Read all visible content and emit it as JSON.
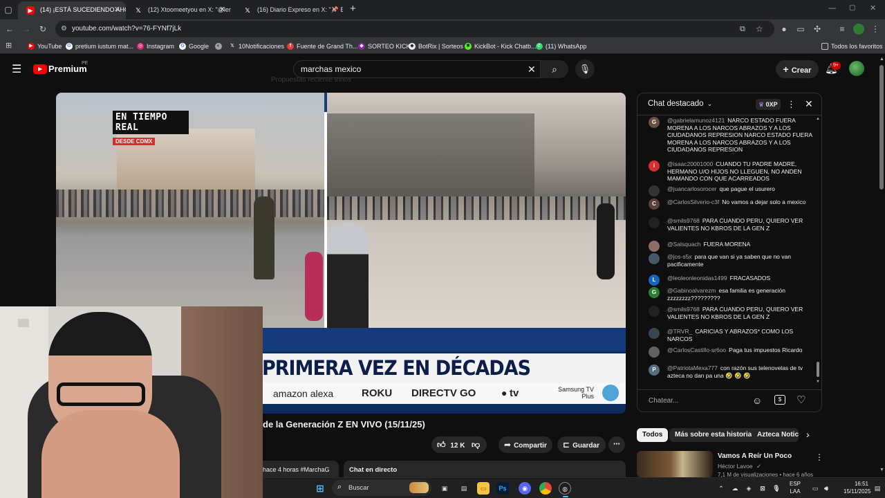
{
  "browser": {
    "tabs": [
      {
        "title": "(14) ¡ESTÁ SUCEDIENDO AHORA",
        "icon": "youtube-icon"
      },
      {
        "title": "(12) Xtoomeetyou en X: \"@lene",
        "icon": "x-icon"
      },
      {
        "title": "(16) Diario Expreso en X: \"📌 E",
        "icon": "x-icon"
      }
    ],
    "new_tab": "+",
    "url": "youtube.com/watch?v=76-FYNf7jLk",
    "bookmarks": [
      "YouTube",
      "pretium iustum mat...",
      "Instagram",
      "Google",
      "",
      "10Notificaciones",
      "Fuente de Grand Th...",
      "SORTEO KICK",
      "BotRix | Sorteos",
      "KickBot - Kick Chatb...",
      "(11) WhatsApp"
    ],
    "all_bookmarks": "Todos los favoritos"
  },
  "youtube": {
    "logo_text": "Premium",
    "logo_region": "PE",
    "search_value": "marchas mexico",
    "create_label": "Crear",
    "notif_count": "9+",
    "ghost_text": "Propuestas reciente trinos"
  },
  "video": {
    "overlay_live": "EN TIEMPO REAL",
    "overlay_source": "DESDE CDMX",
    "banner": "PIA EL ZÓCALO POR PRIMERA VEZ EN DÉCADAS",
    "partners": [
      "amazon alexa",
      "ROKU",
      "DIRECTV GO",
      "tv",
      "Samsung TV Plus"
    ]
  },
  "below": {
    "title": "de la Generación Z EN VIVO (15/11/25)",
    "likes": "12 K",
    "share": "Compartir",
    "save": "Guardar",
    "meta": "hace 4 horas  #MarchaG",
    "live_chat": "Chat en directo"
  },
  "chat": {
    "header": "Chat destacado",
    "xp": "0XP",
    "placeholder": "Chatear...",
    "messages": [
      {
        "author": "@gabrielamunoz4121",
        "text": "NARCO ESTADO FUERA MORENA A LOS NARCOS ABRAZOS Y A LOS CIUDADANOS REPRESION NARCO ESTADO FUERA MORENA A LOS NARCOS ABRAZOS Y A LOS CIUDADANOS REPRESION",
        "av": "G",
        "color": "#6d4c41"
      },
      {
        "author": "@isaac20001000",
        "text": "CUANDO TU PADRE MADRE, HERMANO U/O HIJOS NO LLEGUEN, NO ANDEN MAMANDO CON QUE ACARREADOS",
        "av": "i",
        "color": "#d32f2f"
      },
      {
        "author": "@juancarlosorocer",
        "text": "que pague el usurero",
        "av": "",
        "color": "#333333"
      },
      {
        "author": "@CarlosSilverio-c3f",
        "text": "No vamos a dejar solo a mexico",
        "av": "C",
        "color": "#5d4037"
      },
      {
        "author": "@smils9768",
        "text": "PARA CUANDO PERU, QUIERO VER VALIENTES NO KBROS DE LA GEN Z",
        "av": "",
        "color": "#222222"
      },
      {
        "author": "@Salsquach",
        "text": "FUERA MORENA",
        "av": "",
        "color": "#8d6e63"
      },
      {
        "author": "@jos-s5x",
        "text": "para que van si ya saben que no van pacificamente",
        "av": "",
        "color": "#455a64"
      },
      {
        "author": "@leoleonleonidas1499",
        "text": "FRACASADOS",
        "av": "L",
        "color": "#1565c0"
      },
      {
        "author": "@Gabinoalvarezm",
        "text": "esa familia es generación zzzzzzzz?????????",
        "av": "G",
        "color": "#2e7d32"
      },
      {
        "author": "@smils9768",
        "text": "PARA CUANDO PERU, QUIERO VER VALIENTES NO KBROS DE LA GEN Z",
        "av": "",
        "color": "#222222"
      },
      {
        "author": "@TRVR_",
        "text": "CARICIAS Y ABRAZOS* COMO LOS NARCOS",
        "av": "",
        "color": "#37474f"
      },
      {
        "author": "@CarlosCastillo-sr6oo",
        "text": "Paga tus impuestos Ricardo",
        "av": "",
        "color": "#616161"
      },
      {
        "author": "@PatriotaMexa777",
        "text": "con razón sus telenovelas de tv azteca no dan pa una 🤣 🤣 🤣",
        "av": "P",
        "color": "#546e7a"
      }
    ]
  },
  "related": {
    "chips": [
      "Todos",
      "Más sobre esta historia",
      "Azteca Notici"
    ],
    "item_title": "Vamos A Reír Un Poco",
    "item_channel": "Héctor Lavoe",
    "item_meta": "7,1 M de visualizaciones • hace 6 años"
  },
  "taskbar": {
    "search": "Buscar",
    "lang1": "ESP",
    "lang2": "LAA",
    "time": "16:51",
    "date": "15/11/2025"
  }
}
